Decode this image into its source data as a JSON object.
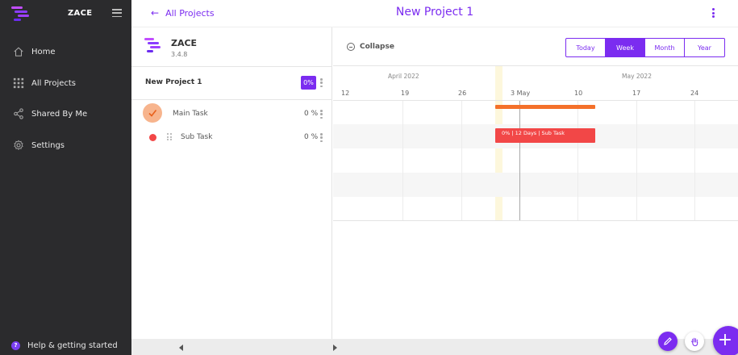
{
  "sidebar": {
    "brand": "ZACE",
    "items": [
      {
        "label": "Home",
        "icon": "home-icon"
      },
      {
        "label": "All Projects",
        "icon": "grid-icon"
      },
      {
        "label": "Shared By Me",
        "icon": "share-icon"
      },
      {
        "label": "Settings",
        "icon": "gear-icon"
      }
    ],
    "help": "Help & getting started"
  },
  "topbar": {
    "back_label": "All Projects",
    "title": "New Project 1"
  },
  "panel": {
    "app_name": "ZACE",
    "version": "3.4.8",
    "project": {
      "name": "New Project 1",
      "progress": "0%"
    },
    "tasks": [
      {
        "name": "Main Task",
        "progress": "0 %"
      },
      {
        "name": "Sub Task",
        "progress": "0 %"
      }
    ]
  },
  "gantt": {
    "collapse_label": "Collapse",
    "scales": [
      "Today",
      "Week",
      "Month",
      "Year"
    ],
    "active_scale": "Week",
    "months": [
      "April 2022",
      "May 2022"
    ],
    "days": [
      "12",
      "19",
      "26",
      "3 May",
      "10",
      "17",
      "24"
    ],
    "subtask_bar_label": "0% | 12 Days | Sub Task"
  },
  "colors": {
    "accent": "#7b2cf0",
    "sidebar_bg": "#2b2b2d",
    "main_task_bar": "#f4702a",
    "sub_task_bar": "#f24747",
    "today_band": "#fdf7dc"
  }
}
